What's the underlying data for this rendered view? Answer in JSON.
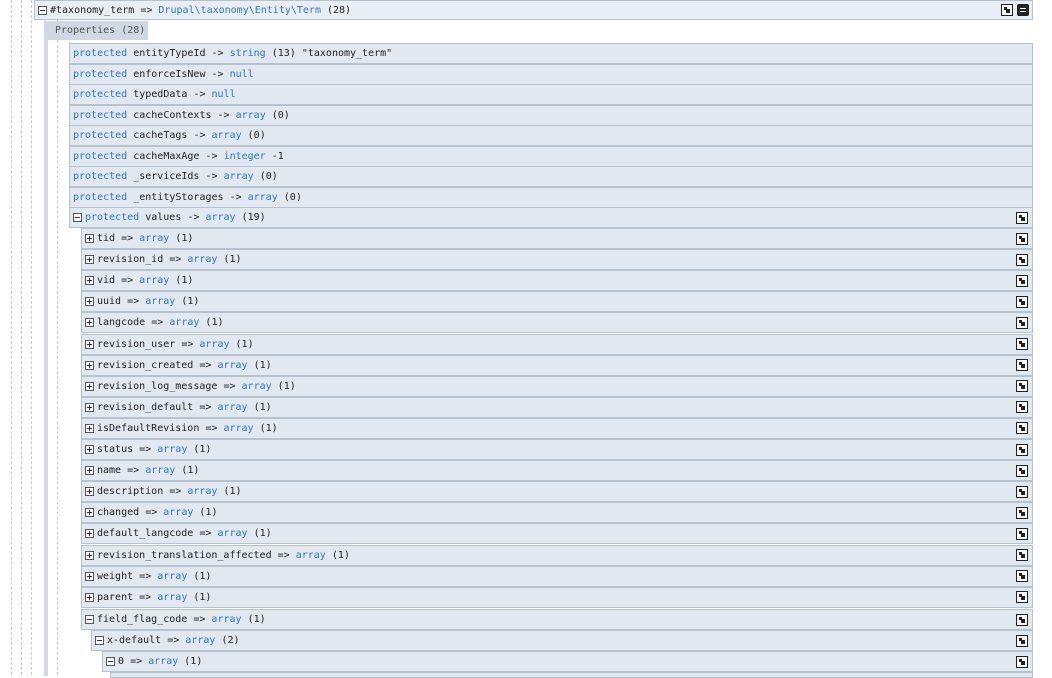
{
  "root": {
    "name": "#taxonomy_term",
    "arrow": "=>",
    "class": "Drupal\\taxonomy\\Entity\\Term",
    "count": "(28)"
  },
  "properties_tab": "Properties (28)",
  "properties": [
    {
      "vis": "protected",
      "name": "entityTypeId",
      "arrow": "->",
      "type": "string",
      "info": "(13) \"taxonomy_term\""
    },
    {
      "vis": "protected",
      "name": "enforceIsNew",
      "arrow": "->",
      "type": "null",
      "info": ""
    },
    {
      "vis": "protected",
      "name": "typedData",
      "arrow": "->",
      "type": "null",
      "info": ""
    },
    {
      "vis": "protected",
      "name": "cacheContexts",
      "arrow": "->",
      "type": "array",
      "info": "(0)"
    },
    {
      "vis": "protected",
      "name": "cacheTags",
      "arrow": "->",
      "type": "array",
      "info": "(0)"
    },
    {
      "vis": "protected",
      "name": "cacheMaxAge",
      "arrow": "->",
      "type": "integer",
      "info": "-1"
    },
    {
      "vis": "protected",
      "name": "_serviceIds",
      "arrow": "->",
      "type": "array",
      "info": "(0)"
    },
    {
      "vis": "protected",
      "name": "_entityStorages",
      "arrow": "->",
      "type": "array",
      "info": "(0)"
    }
  ],
  "values": {
    "vis": "protected",
    "name": "values",
    "arrow": "->",
    "type": "array",
    "info": "(19)"
  },
  "value_items": [
    {
      "name": "tid",
      "arrow": "=>",
      "type": "array",
      "info": "(1)"
    },
    {
      "name": "revision_id",
      "arrow": "=>",
      "type": "array",
      "info": "(1)"
    },
    {
      "name": "vid",
      "arrow": "=>",
      "type": "array",
      "info": "(1)"
    },
    {
      "name": "uuid",
      "arrow": "=>",
      "type": "array",
      "info": "(1)"
    },
    {
      "name": "langcode",
      "arrow": "=>",
      "type": "array",
      "info": "(1)"
    },
    {
      "name": "revision_user",
      "arrow": "=>",
      "type": "array",
      "info": "(1)"
    },
    {
      "name": "revision_created",
      "arrow": "=>",
      "type": "array",
      "info": "(1)"
    },
    {
      "name": "revision_log_message",
      "arrow": "=>",
      "type": "array",
      "info": "(1)"
    },
    {
      "name": "revision_default",
      "arrow": "=>",
      "type": "array",
      "info": "(1)"
    },
    {
      "name": "isDefaultRevision",
      "arrow": "=>",
      "type": "array",
      "info": "(1)"
    },
    {
      "name": "status",
      "arrow": "=>",
      "type": "array",
      "info": "(1)"
    },
    {
      "name": "name",
      "arrow": "=>",
      "type": "array",
      "info": "(1)"
    },
    {
      "name": "description",
      "arrow": "=>",
      "type": "array",
      "info": "(1)"
    },
    {
      "name": "changed",
      "arrow": "=>",
      "type": "array",
      "info": "(1)"
    },
    {
      "name": "default_langcode",
      "arrow": "=>",
      "type": "array",
      "info": "(1)"
    },
    {
      "name": "revision_translation_affected",
      "arrow": "=>",
      "type": "array",
      "info": "(1)"
    },
    {
      "name": "weight",
      "arrow": "=>",
      "type": "array",
      "info": "(1)"
    },
    {
      "name": "parent",
      "arrow": "=>",
      "type": "array",
      "info": "(1)"
    }
  ],
  "field_flag_code": {
    "name": "field_flag_code",
    "arrow": "=>",
    "type": "array",
    "info": "(1)"
  },
  "x_default": {
    "name": "x-default",
    "arrow": "=>",
    "type": "array",
    "info": "(2)"
  },
  "item_zero": {
    "name": "0",
    "arrow": "=>",
    "type": "array",
    "info": "(1)"
  },
  "icons": {
    "collapse": "minus-box-icon",
    "expand": "plus-box-icon",
    "copy_path": "copy-path-icon",
    "toggle_all": "toggle-all-icon"
  },
  "colors": {
    "keyword": "#2f78c7",
    "row_bg": "#e2e8f0",
    "row_border": "#b7c2cf",
    "tab_bg": "#cfd8e3"
  }
}
